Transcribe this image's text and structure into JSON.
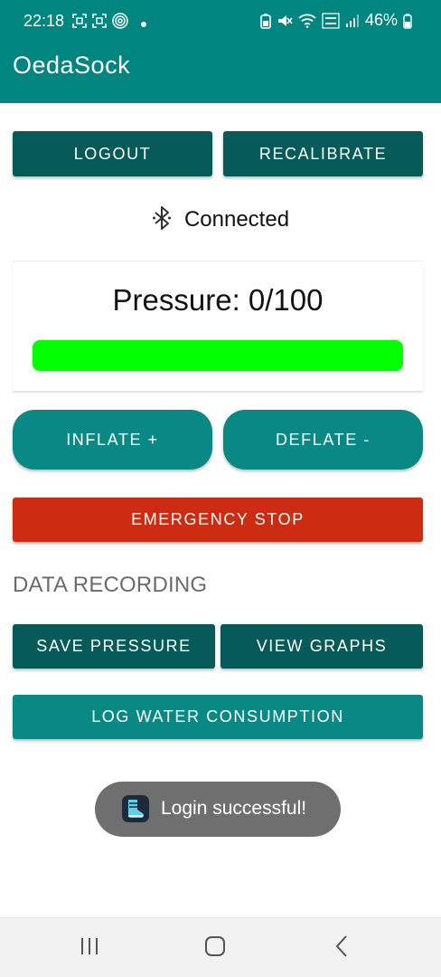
{
  "status_bar": {
    "time": "22:18",
    "battery_percent": "46%",
    "left_icons": [
      "screenshot-icon",
      "screenshot-icon",
      "fingerprint-icon",
      "dot-icon"
    ],
    "right_icons": [
      "battery-saver-icon",
      "mute-icon",
      "wifi-icon",
      "volte-icon",
      "signal-icon",
      "battery-icon"
    ]
  },
  "app_bar": {
    "title": "OedaSock"
  },
  "top_buttons": {
    "logout": "LOGOUT",
    "recalibrate": "RECALIBRATE"
  },
  "connection": {
    "status": "Connected",
    "icon": "bluetooth-icon"
  },
  "pressure": {
    "label": "Pressure: 0/100",
    "bar_color": "#00ff00"
  },
  "controls": {
    "inflate": "INFLATE +",
    "deflate": "DEFLATE -",
    "emergency_stop": "EMERGENCY STOP"
  },
  "data_recording": {
    "heading": "DATA RECORDING",
    "save_pressure": "SAVE PRESSURE",
    "view_graphs": "VIEW GRAPHS",
    "log_water": "LOG WATER CONSUMPTION"
  },
  "toast": {
    "message": "Login successful!",
    "icon": "sock-app-icon"
  },
  "nav_bar": {
    "buttons": [
      "recent-apps-icon",
      "home-icon",
      "back-icon"
    ]
  },
  "colors": {
    "primary": "#00857f",
    "dark_button": "#065a57",
    "teal_button": "#0a8984",
    "danger": "#cc2d12",
    "toast_bg": "#6f6f6f"
  }
}
